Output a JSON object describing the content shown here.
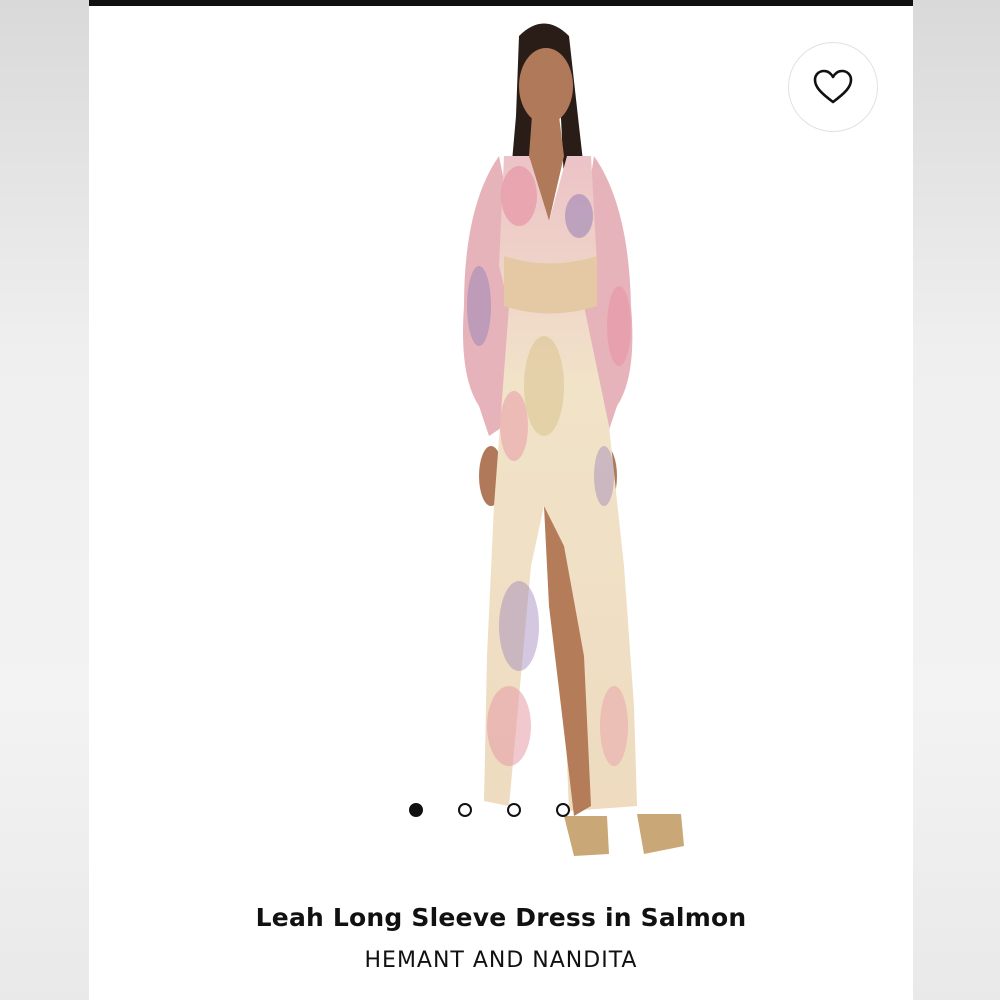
{
  "product": {
    "title": "Leah Long Sleeve Dress in Salmon",
    "brand": "HEMANT AND NANDITA",
    "image_alt": "Leah Long Sleeve Dress in Salmon"
  },
  "favorite": {
    "icon": "heart-outline-icon",
    "label": "Add to favorites"
  },
  "carousel": {
    "total": 4,
    "active": 1
  },
  "colors": {
    "top_bar": "#111111",
    "text": "#111111",
    "dress_base": "#efe0c4",
    "dress_pink": "#e79aa8",
    "dress_purple": "#9d86b8"
  }
}
